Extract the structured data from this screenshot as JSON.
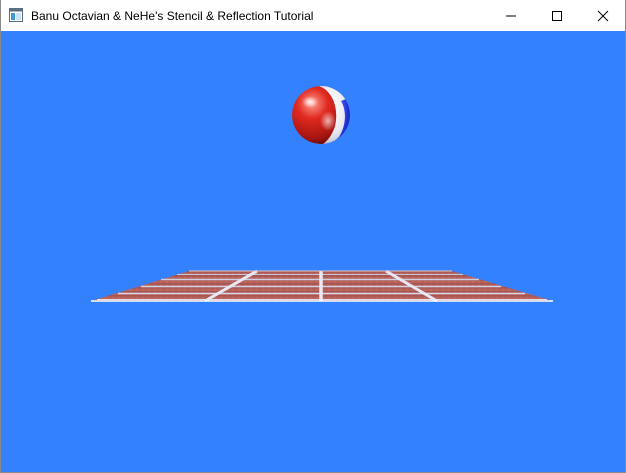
{
  "window": {
    "title": "Banu Octavian & NeHe's Stencil & Reflection Tutorial",
    "background_color": "#3381ff"
  },
  "title_bar": {
    "icon": "app-window-icon",
    "controls": [
      {
        "name": "minimize-button",
        "icon": "minimize-icon"
      },
      {
        "name": "maximize-button",
        "icon": "maximize-icon"
      },
      {
        "name": "close-button",
        "icon": "close-icon"
      }
    ]
  },
  "scene": {
    "ball": {
      "colors": [
        "#d6201a",
        "#ffffff",
        "#1a2fd1"
      ]
    },
    "floor": {
      "tile_color": "#b65c58",
      "grout_color": "#d9d9e8"
    }
  }
}
